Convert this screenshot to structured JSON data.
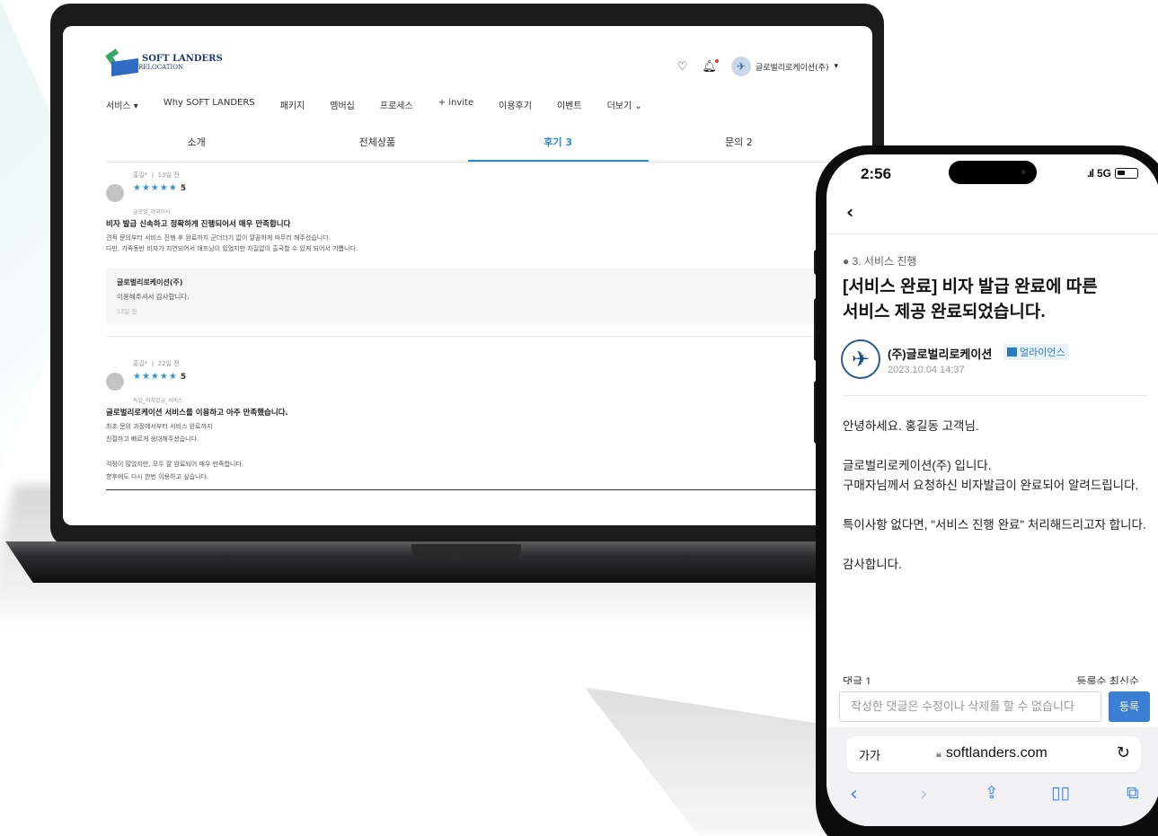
{
  "website": {
    "logo": {
      "line1": "SOFT LANDERS",
      "line2": "RELOCATION"
    },
    "header": {
      "user_name": "글로벌리로케이션(주)"
    },
    "nav": [
      "서비스 ▾",
      "Why SOFT LANDERS",
      "패키지",
      "멤버십",
      "프로세스",
      "+ invite",
      "이용후기",
      "이벤트",
      "더보기 ⌄"
    ],
    "tabs": [
      "소개",
      "전체상품",
      "후기 3",
      "문의 2"
    ],
    "active_tab": "후기 3",
    "reviews": [
      {
        "author": "홍길*",
        "time": "13일 전",
        "stars": "★★★★★",
        "score": "5",
        "tag": "글로벌_해외이사",
        "title": "비자 발급 신속하고 정확하게 진행되어서 매우 만족합니다",
        "body1": "견적 문의부터 서비스 진행 후 완료까지 군더더기 없이 깔끔하게 마무리 해주셨습니다.",
        "body2": "다만, 가족동반 비자가 지연되어서 애프닝이 있었지만 차질없이 출국할 수 있게 되어서 기쁩니다.",
        "reply": {
          "name": "글로벌리로케이션(주)",
          "text": "이용해주셔서 감사합니다.",
          "time": "13일 전"
        }
      },
      {
        "author": "홍길*",
        "time": "22일 전",
        "stars": "★★★★★",
        "score": "5",
        "tag": "독일_비자발급_서비스",
        "title": "글로벌리로케이션 서비스를 이용하고 아주 만족했습니다.",
        "body1": "최초 문의 과정에서부터 서비스 완료까지",
        "body2": "친절하고 빠르게 응대해주셨습니다.",
        "body3": "걱정이 많았지만, 모두 잘 완료되어 매우 만족합니다.",
        "body4": "향후에도 다시 한번 이용하고 싶습니다."
      }
    ]
  },
  "phone": {
    "status": {
      "time": "2:56",
      "network": "5G"
    },
    "category": "● 3. 서비스 진행",
    "title": "[서비스 완료] 비자 발급 완료에 따른 서비스 제공 완료되었습니다.",
    "author": "(주)글로벌리로케이션",
    "badge": "얼라이언스",
    "date": "2023.10.04 14:37",
    "body": [
      "안녕하세요. 홍길동 고객님.",
      "글로벌리로케이션(주) 입니다.\n구매자님께서 요청하신 비자발급이 완료되어 알려드립니다.",
      "특이사항 없다면, \"서비스 진행 완료\" 처리해드리고자 합니다.",
      "감사합니다."
    ],
    "comments_header": {
      "left": "댓글 1",
      "right": "등록순  최신순"
    },
    "comment_placeholder": "작성한 댓글은 수정이나 삭제를 할 수 없습니다",
    "comment_button": "등록",
    "browser": {
      "aa": "가가",
      "url": "softlanders.com"
    }
  }
}
